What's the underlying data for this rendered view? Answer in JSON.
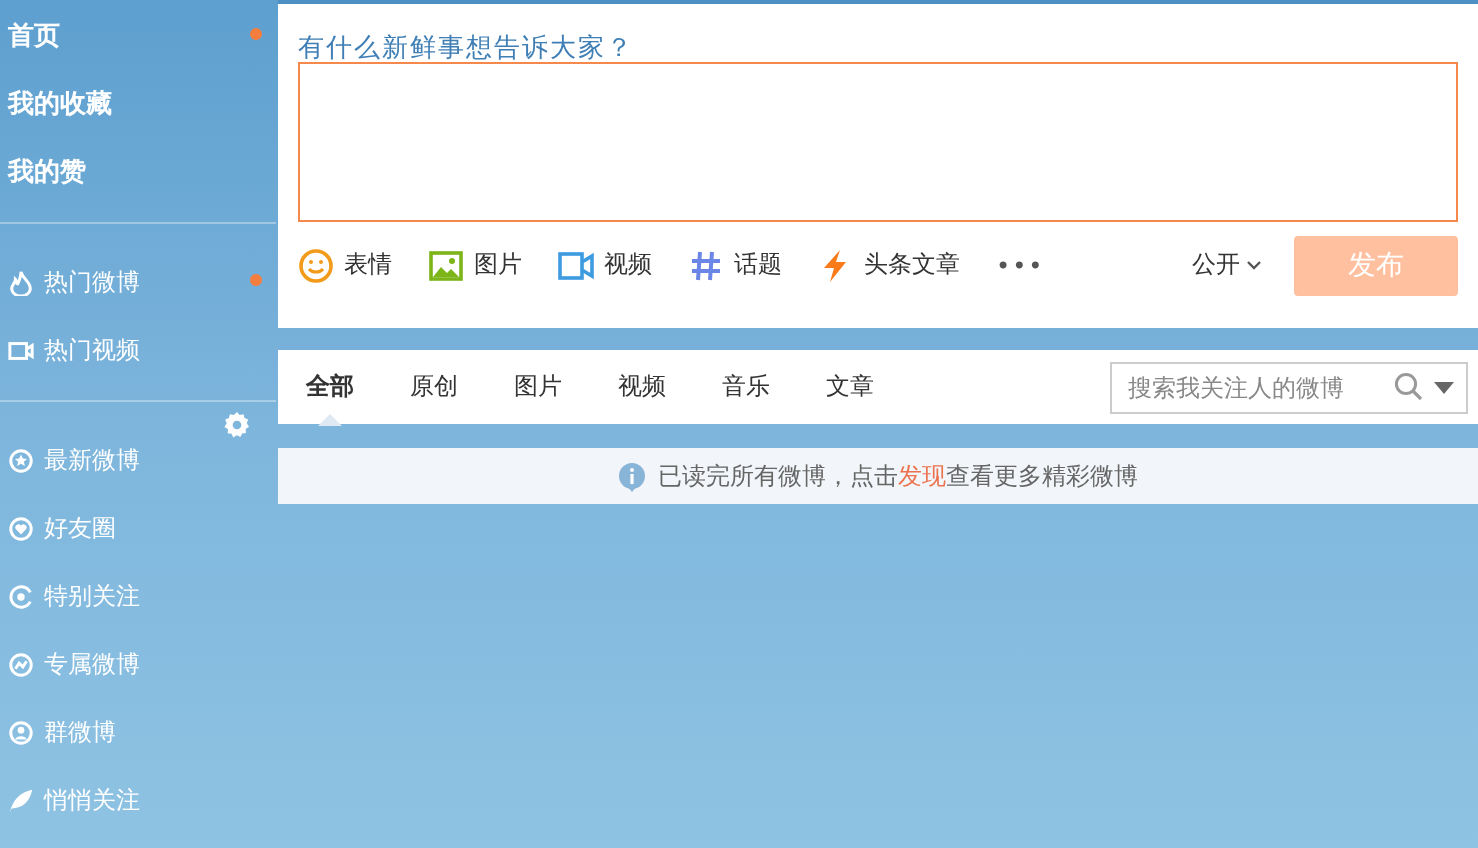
{
  "sidebar": {
    "groups": [
      {
        "items": [
          {
            "label": "首页",
            "badge": true
          },
          {
            "label": "我的收藏",
            "badge": false
          },
          {
            "label": "我的赞",
            "badge": false
          }
        ]
      },
      {
        "items": [
          {
            "label": "热门微博",
            "badge": true
          },
          {
            "label": "热门视频",
            "badge": false
          }
        ]
      },
      {
        "items": [
          {
            "label": "最新微博",
            "badge": false
          },
          {
            "label": "好友圈",
            "badge": false
          },
          {
            "label": "特别关注",
            "badge": false
          },
          {
            "label": "专属微博",
            "badge": false
          },
          {
            "label": "群微博",
            "badge": false
          },
          {
            "label": "悄悄关注",
            "badge": false
          }
        ]
      }
    ]
  },
  "composer": {
    "prompt": "有什么新鲜事想告诉大家？",
    "focused": true,
    "tools": [
      {
        "kind": "emoji",
        "label": "表情"
      },
      {
        "kind": "image",
        "label": "图片"
      },
      {
        "kind": "video",
        "label": "视频"
      },
      {
        "kind": "topic",
        "label": "话题"
      },
      {
        "kind": "article",
        "label": "头条文章"
      },
      {
        "kind": "more",
        "label": "•••"
      }
    ],
    "visibility": "公开",
    "publish": {
      "label": "发布",
      "disabled": true
    }
  },
  "feed_tabs": [
    {
      "label": "全部",
      "selected": true
    },
    {
      "label": "原创",
      "selected": false
    },
    {
      "label": "图片",
      "selected": false
    },
    {
      "label": "视频",
      "selected": false
    },
    {
      "label": "音乐",
      "selected": false
    },
    {
      "label": "文章",
      "selected": false
    }
  ],
  "search": {
    "placeholder": "搜索我关注人的微博"
  },
  "notice": {
    "before": "已读完所有微博，点击",
    "link": "发现",
    "after": "查看更多精彩微博"
  }
}
